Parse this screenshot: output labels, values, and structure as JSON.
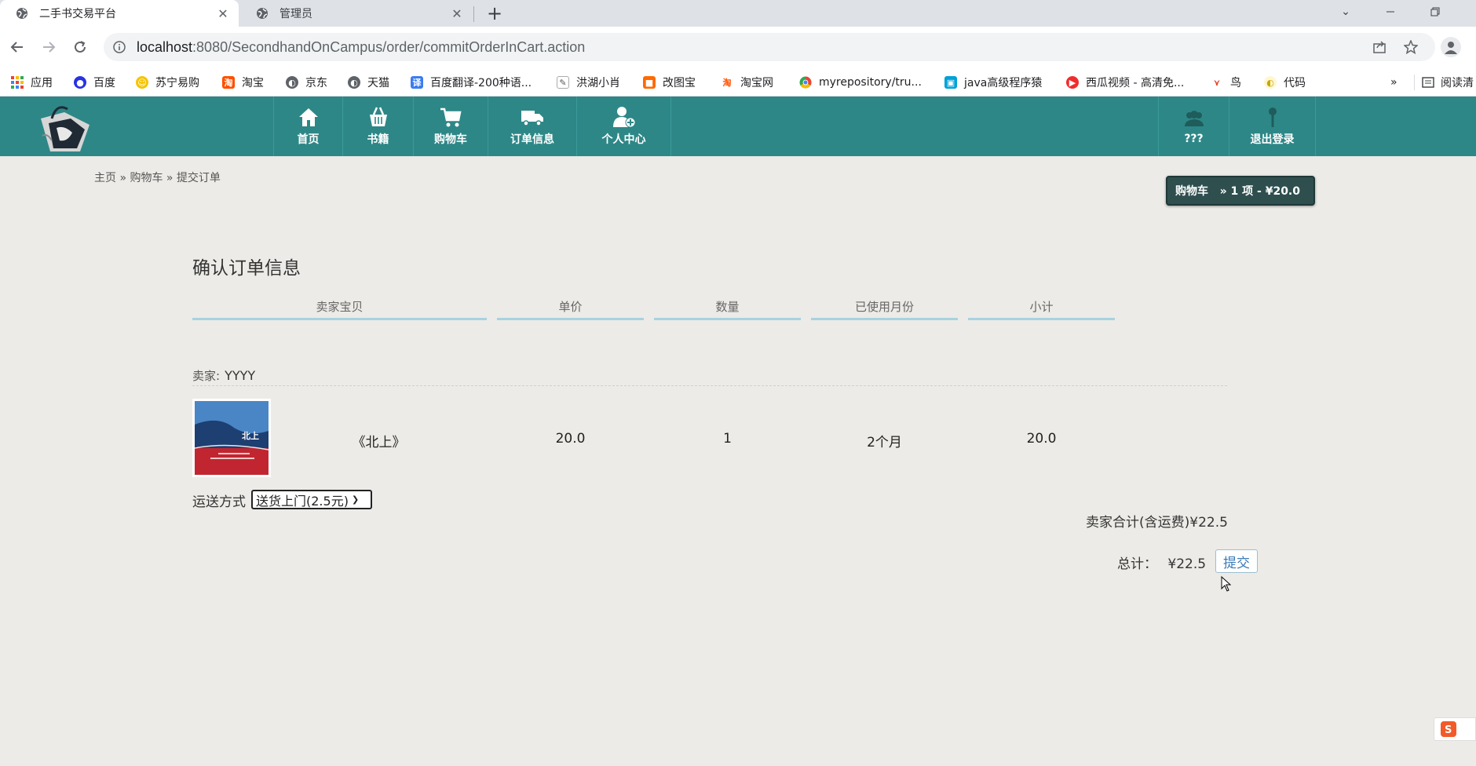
{
  "browser": {
    "tabs": [
      {
        "title": "二手书交易平台",
        "active": true
      },
      {
        "title": "管理员",
        "active": false
      }
    ],
    "url_host": "localhost",
    "url_path": ":8080/SecondhandOnCampus/order/commitOrderInCart.action",
    "bookmarks": [
      {
        "label": "应用",
        "icon": "apps-grid-icon",
        "color": "#e94235"
      },
      {
        "label": "百度",
        "icon": "baidu-paw-icon",
        "color": "#2932e1"
      },
      {
        "label": "苏宁易购",
        "icon": "suning-icon",
        "color": "#f5c400"
      },
      {
        "label": "淘宝",
        "icon": "taobao-icon",
        "color": "#ff5000"
      },
      {
        "label": "京东",
        "icon": "globe-icon",
        "color": "#5f6368"
      },
      {
        "label": "天猫",
        "icon": "globe-icon",
        "color": "#5f6368"
      },
      {
        "label": "百度翻译-200种语...",
        "icon": "translate-icon",
        "color": "#3a7cf0"
      },
      {
        "label": "洪湖小肖",
        "icon": "feather-icon",
        "color": "#555555"
      },
      {
        "label": "改图宝",
        "icon": "gaitubao-icon",
        "color": "#ff6a00"
      },
      {
        "label": "淘宝网",
        "icon": "taobao-icon",
        "color": "#ff5000"
      },
      {
        "label": "myrepository/tru...",
        "icon": "chrome-icon",
        "color": "#34a853"
      },
      {
        "label": "java高级程序猿",
        "icon": "bilibili-icon",
        "color": "#00a1d6"
      },
      {
        "label": "西瓜视频 - 高清免...",
        "icon": "xigua-icon",
        "color": "#f02c2c"
      },
      {
        "label": "鸟",
        "icon": "bird-icon",
        "color": "#e8462b"
      },
      {
        "label": "代码",
        "icon": "code-icon",
        "color": "#e6c84a"
      }
    ],
    "more_label": "»",
    "reading_list": "阅读清"
  },
  "site": {
    "nav": [
      {
        "label": "首页",
        "icon": "home-icon"
      },
      {
        "label": "书籍",
        "icon": "basket-icon"
      },
      {
        "label": "购物车",
        "icon": "cart-icon"
      },
      {
        "label": "订单信息",
        "icon": "truck-icon"
      },
      {
        "label": "个人中心",
        "icon": "user-add-icon"
      }
    ],
    "nav_right": [
      {
        "label": "???",
        "icon": "users-icon"
      },
      {
        "label": "退出登录",
        "icon": "pin-icon"
      }
    ]
  },
  "breadcrumb": {
    "home": "主页",
    "sep": " » ",
    "cart": "购物车",
    "current": "提交订单"
  },
  "cart_badge": "购物车   » 1 项 - ¥20.0",
  "page_title": "确认订单信息",
  "columns": [
    "卖家宝贝",
    "单价",
    "数量",
    "已使用月份",
    "小计"
  ],
  "seller": {
    "label": "卖家:",
    "name": "YYYY"
  },
  "items": [
    {
      "title": "《北上》",
      "price": "20.0",
      "qty": "1",
      "months": "2个月",
      "subtotal": "20.0",
      "cover_text": "北上"
    }
  ],
  "shipping": {
    "label": "运送方式",
    "selected": "送货上门(2.5元)"
  },
  "seller_total": "卖家合计(含运费)¥22.5",
  "grand_total": {
    "label": "总计：",
    "value": "¥22.5"
  },
  "submit_label": "提交",
  "colors": {
    "header": "#2e8787",
    "page_bg": "#ecebe7",
    "badge": "#2f4f4f",
    "underline": "#a8d2e0"
  }
}
